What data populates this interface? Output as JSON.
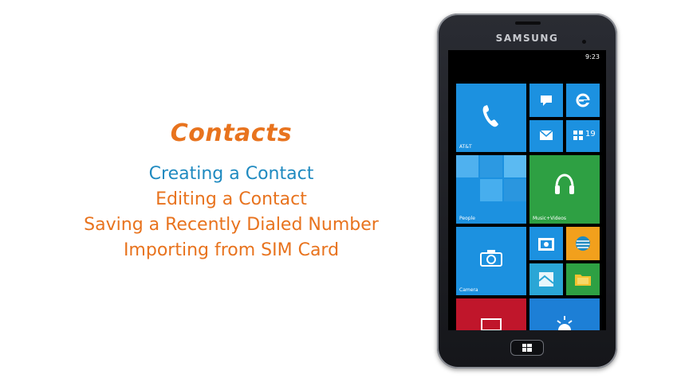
{
  "menu": {
    "title": "Contacts",
    "items": [
      {
        "label": "Creating a Contact",
        "active": true
      },
      {
        "label": "Editing a Contact"
      },
      {
        "label": "Saving a Recently Dialed Number"
      },
      {
        "label": "Importing from SIM Card"
      }
    ]
  },
  "phone": {
    "brand": "SAMSUNG",
    "clock": "9:23",
    "tiles": {
      "phone_label": "AT&T",
      "store_badge": "19",
      "people_label": "People",
      "music_label": "Music+Videos",
      "camera_label": "Camera"
    }
  },
  "colors": {
    "accent_orange": "#e8731e",
    "accent_blue": "#1f8ac0",
    "tile_blue": "#1c91e0",
    "tile_green": "#2ea043"
  }
}
